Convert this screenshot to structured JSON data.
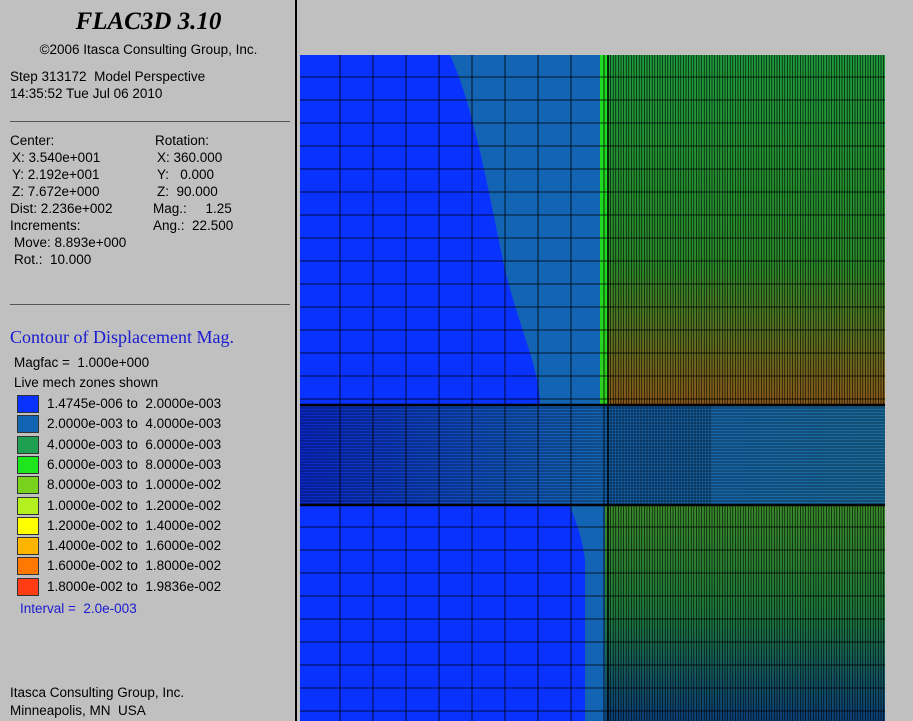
{
  "header": {
    "app_title": "FLAC3D 3.10",
    "copyright": "©2006 Itasca Consulting Group, Inc.",
    "step_line": "Step 313172  Model Perspective",
    "timestamp": "14:35:52 Tue Jul 06 2010"
  },
  "view": {
    "center_label": "Center:",
    "center_x": "X: 3.540e+001",
    "center_y": "Y: 2.192e+001",
    "center_z": "Z: 7.672e+000",
    "dist": "Dist: 2.236e+002",
    "rotation_label": "Rotation:",
    "rot_x": "X: 360.000",
    "rot_y": "Y:   0.000",
    "rot_z": "Z:  90.000",
    "mag": "Mag.:     1.25",
    "increments_label": "Increments:",
    "ang": "Ang.:  22.500",
    "move": "Move: 8.893e+000",
    "rot": "Rot.:  10.000"
  },
  "contour": {
    "title": "Contour of Displacement Mag.",
    "magfac": "Magfac =  1.000e+000",
    "zones": "Live mech zones shown",
    "interval": "Interval =  2.0e-003",
    "ranges": [
      {
        "label": "1.4745e-006 to  2.0000e-003",
        "color": "#0a32ff"
      },
      {
        "label": "2.0000e-003 to  4.0000e-003",
        "color": "#1464b4"
      },
      {
        "label": "4.0000e-003 to  6.0000e-003",
        "color": "#1ea050"
      },
      {
        "label": "6.0000e-003 to  8.0000e-003",
        "color": "#1ee61e"
      },
      {
        "label": "8.0000e-003 to  1.0000e-002",
        "color": "#78d21e"
      },
      {
        "label": "1.0000e-002 to  1.2000e-002",
        "color": "#b4f01e"
      },
      {
        "label": "1.2000e-002 to  1.4000e-002",
        "color": "#ffff00"
      },
      {
        "label": "1.4000e-002 to  1.6000e-002",
        "color": "#ffb400"
      },
      {
        "label": "1.6000e-002 to  1.8000e-002",
        "color": "#ff7800"
      },
      {
        "label": "1.8000e-002 to  1.9836e-002",
        "color": "#ff3c14"
      }
    ]
  },
  "footer": {
    "company": "Itasca Consulting Group, Inc.",
    "location": "Minneapolis, MN  USA"
  }
}
